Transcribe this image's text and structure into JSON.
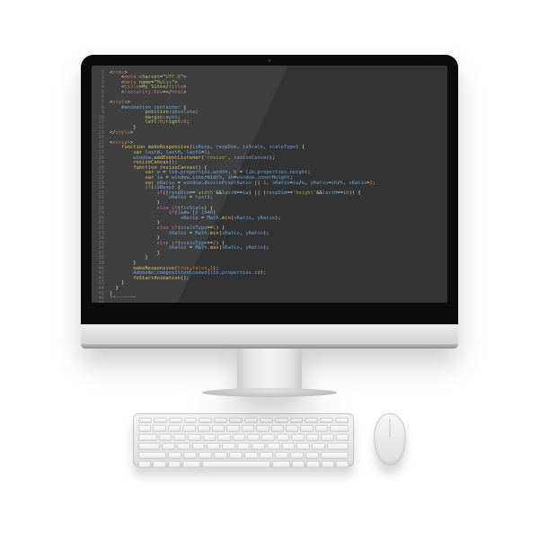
{
  "editor": {
    "line_count": 47,
    "code": [
      [
        [
          "pun",
          "<"
        ],
        [
          "tag",
          "html"
        ],
        [
          "pun",
          ">"
        ]
      ],
      [
        [
          "pun",
          "    <"
        ],
        [
          "tag",
          "meta "
        ],
        [
          "attr",
          "charset"
        ],
        [
          "pun",
          "=\""
        ],
        [
          "str",
          "UTF-8"
        ],
        [
          "pun",
          "\">"
        ]
      ],
      [
        [
          "pun",
          "    <"
        ],
        [
          "tag",
          "meta "
        ],
        [
          "attr",
          "name"
        ],
        [
          "pun",
          "=\""
        ],
        [
          "str",
          "MyCss"
        ],
        [
          "pun",
          "\">"
        ]
      ],
      [
        [
          "pun",
          "    <"
        ],
        [
          "tag",
          "title"
        ],
        [
          "pun",
          ">"
        ],
        [
          "attr",
          "My Site"
        ],
        [
          "pun",
          "</"
        ],
        [
          "tag",
          "title"
        ],
        [
          "pun",
          ">"
        ]
      ],
      [
        [
          "pun",
          "    <"
        ],
        [
          "ctrl",
          "!security.Dev"
        ],
        [
          "pun",
          "=</"
        ],
        [
          "tag",
          "html"
        ],
        [
          "pun",
          ">"
        ]
      ],
      [],
      [
        [
          "pun",
          "<"
        ],
        [
          "tag",
          "style"
        ],
        [
          "pun",
          ">"
        ]
      ],
      [
        [
          "pun",
          "    "
        ],
        [
          "id",
          "#animation_container"
        ],
        [
          "pun",
          " {"
        ]
      ],
      [
        [
          "pun",
          "            "
        ],
        [
          "attr",
          "position"
        ],
        [
          "pun",
          ":"
        ],
        [
          "id",
          "absolute"
        ],
        [
          "pun",
          ";"
        ]
      ],
      [
        [
          "pun",
          "            "
        ],
        [
          "attr",
          "margin"
        ],
        [
          "pun",
          ":"
        ],
        [
          "id",
          "auto"
        ],
        [
          "pun",
          ";"
        ]
      ],
      [
        [
          "pun",
          "            "
        ],
        [
          "attr",
          "left"
        ],
        [
          "pun",
          ":"
        ],
        [
          "num",
          "0"
        ],
        [
          "pun",
          ";"
        ],
        [
          "attr",
          "right"
        ],
        [
          "pun",
          ":"
        ],
        [
          "num",
          "0"
        ],
        [
          "pun",
          ";"
        ]
      ],
      [
        [
          "pun",
          "        }"
        ]
      ],
      [
        [
          "pun",
          "</"
        ],
        [
          "tag",
          "style"
        ],
        [
          "pun",
          ">"
        ]
      ],
      [],
      [
        [
          "pun",
          "<"
        ],
        [
          "tag",
          "script"
        ],
        [
          "pun",
          ">"
        ]
      ],
      [
        [
          "pun",
          "    "
        ],
        [
          "kw",
          "function "
        ],
        [
          "fn",
          "makeResponsive"
        ],
        [
          "pun",
          "("
        ],
        [
          "id",
          "isResp"
        ],
        [
          "pun",
          ", "
        ],
        [
          "id",
          "respDim"
        ],
        [
          "pun",
          ", "
        ],
        [
          "id",
          "isScale"
        ],
        [
          "pun",
          ", "
        ],
        [
          "id",
          "scaleType"
        ],
        [
          "pun",
          ") {"
        ]
      ],
      [
        [
          "pun",
          "        "
        ],
        [
          "kw",
          "var "
        ],
        [
          "id",
          "lastW"
        ],
        [
          "pun",
          ", "
        ],
        [
          "id",
          "lastH"
        ],
        [
          "pun",
          ", "
        ],
        [
          "id",
          "lastS"
        ],
        [
          "pun",
          "="
        ],
        [
          "num",
          "1"
        ],
        [
          "pun",
          ";"
        ]
      ],
      [
        [
          "pun",
          "        "
        ],
        [
          "id",
          "window"
        ],
        [
          "pun",
          "."
        ],
        [
          "fn",
          "addEventListener"
        ],
        [
          "pun",
          "("
        ],
        [
          "str",
          "'resize'"
        ],
        [
          "pun",
          ", "
        ],
        [
          "id",
          "resizeCanvas"
        ],
        [
          "pun",
          ");"
        ]
      ],
      [
        [
          "pun",
          "        "
        ],
        [
          "fn",
          "resizeCanvas"
        ],
        [
          "pun",
          "();"
        ]
      ],
      [
        [
          "pun",
          "        "
        ],
        [
          "kw",
          "function "
        ],
        [
          "fn",
          "resizeCanvas"
        ],
        [
          "pun",
          "() {"
        ]
      ],
      [
        [
          "pun",
          "            "
        ],
        [
          "kw",
          "var "
        ],
        [
          "id",
          "w "
        ],
        [
          "pun",
          "= "
        ],
        [
          "id",
          "lib"
        ],
        [
          "pun",
          "."
        ],
        [
          "id",
          "properties"
        ],
        [
          "pun",
          "."
        ],
        [
          "id",
          "width"
        ],
        [
          "pun",
          ", "
        ],
        [
          "id",
          "h "
        ],
        [
          "pun",
          "= "
        ],
        [
          "id",
          "lib"
        ],
        [
          "pun",
          "."
        ],
        [
          "id",
          "properties"
        ],
        [
          "pun",
          "."
        ],
        [
          "id",
          "height"
        ],
        [
          "pun",
          ";"
        ]
      ],
      [
        [
          "pun",
          "            "
        ],
        [
          "kw",
          "var "
        ],
        [
          "id",
          "iw "
        ],
        [
          "pun",
          "= "
        ],
        [
          "id",
          "window"
        ],
        [
          "pun",
          "."
        ],
        [
          "id",
          "innerWidth"
        ],
        [
          "pun",
          ", "
        ],
        [
          "id",
          "ih"
        ],
        [
          "pun",
          "="
        ],
        [
          "id",
          "window"
        ],
        [
          "pun",
          "."
        ],
        [
          "id",
          "innerHeight"
        ],
        [
          "pun",
          ";"
        ]
      ],
      [
        [
          "pun",
          "            "
        ],
        [
          "kw",
          "var "
        ],
        [
          "id",
          "pRatio "
        ],
        [
          "pun",
          "= "
        ],
        [
          "id",
          "window"
        ],
        [
          "pun",
          "."
        ],
        [
          "id",
          "devicePixelRatio "
        ],
        [
          "pun",
          "|| "
        ],
        [
          "num",
          "1"
        ],
        [
          "pun",
          ", "
        ],
        [
          "id",
          "xRatio"
        ],
        [
          "pun",
          "="
        ],
        [
          "id",
          "iw"
        ],
        [
          "pun",
          "/"
        ],
        [
          "id",
          "w"
        ],
        [
          "pun",
          ", "
        ],
        [
          "id",
          "yRatio"
        ],
        [
          "pun",
          "="
        ],
        [
          "id",
          "ih"
        ],
        [
          "pun",
          "/"
        ],
        [
          "id",
          "h"
        ],
        [
          "pun",
          ", "
        ],
        [
          "id",
          "sRatio"
        ],
        [
          "pun",
          "="
        ],
        [
          "num",
          "1"
        ],
        [
          "pun",
          ";"
        ]
      ],
      [
        [
          "pun",
          "            "
        ],
        [
          "ctrl",
          "if"
        ],
        [
          "pun",
          "("
        ],
        [
          "id",
          "isResp"
        ],
        [
          "pun",
          ") {"
        ]
      ],
      [
        [
          "pun",
          "                "
        ],
        [
          "ctrl",
          "if"
        ],
        [
          "pun",
          "(("
        ],
        [
          "id",
          "respDim"
        ],
        [
          "pun",
          "=="
        ],
        [
          "str",
          "'width'"
        ],
        [
          "pun",
          "&&"
        ],
        [
          "id",
          "lastW"
        ],
        [
          "pun",
          "=="
        ],
        [
          "id",
          "iw"
        ],
        [
          "pun",
          ") || ("
        ],
        [
          "id",
          "respDim"
        ],
        [
          "pun",
          "=="
        ],
        [
          "str",
          "'height'"
        ],
        [
          "pun",
          "&&"
        ],
        [
          "id",
          "lastH"
        ],
        [
          "pun",
          "=="
        ],
        [
          "id",
          "ih"
        ],
        [
          "pun",
          ")) {"
        ]
      ],
      [
        [
          "pun",
          "                    "
        ],
        [
          "id",
          "sRatio "
        ],
        [
          "pun",
          "= "
        ],
        [
          "id",
          "lastS"
        ],
        [
          "pun",
          ";"
        ]
      ],
      [
        [
          "pun",
          "                }"
        ]
      ],
      [
        [
          "pun",
          "                "
        ],
        [
          "ctrl",
          "else if"
        ],
        [
          "pun",
          "(!"
        ],
        [
          "id",
          "isScale"
        ],
        [
          "pun",
          ") {"
        ]
      ],
      [
        [
          "pun",
          "                    "
        ],
        [
          "ctrl",
          "if"
        ],
        [
          "pun",
          "("
        ],
        [
          "id",
          "iw"
        ],
        [
          "pun",
          "<"
        ],
        [
          "id",
          "w "
        ],
        [
          "pun",
          "|| "
        ],
        [
          "id",
          "ih"
        ],
        [
          "pun",
          "<"
        ],
        [
          "id",
          "h"
        ],
        [
          "pun",
          ")"
        ]
      ],
      [
        [
          "pun",
          "                        "
        ],
        [
          "id",
          "sRatio "
        ],
        [
          "pun",
          "= "
        ],
        [
          "id",
          "Math"
        ],
        [
          "pun",
          "."
        ],
        [
          "fn",
          "min"
        ],
        [
          "pun",
          "("
        ],
        [
          "id",
          "xRatio"
        ],
        [
          "pun",
          ", "
        ],
        [
          "id",
          "yRatio"
        ],
        [
          "pun",
          ");"
        ]
      ],
      [
        [
          "pun",
          "                }"
        ]
      ],
      [
        [
          "pun",
          "                "
        ],
        [
          "ctrl",
          "else if"
        ],
        [
          "pun",
          "("
        ],
        [
          "id",
          "scaleType"
        ],
        [
          "pun",
          "=="
        ],
        [
          "num",
          "1"
        ],
        [
          "pun",
          ") {"
        ]
      ],
      [
        [
          "pun",
          "                    "
        ],
        [
          "id",
          "sRatio "
        ],
        [
          "pun",
          "= "
        ],
        [
          "id",
          "Math"
        ],
        [
          "pun",
          "."
        ],
        [
          "fn",
          "min"
        ],
        [
          "pun",
          "("
        ],
        [
          "id",
          "xRatio"
        ],
        [
          "pun",
          ", "
        ],
        [
          "id",
          "yRatio"
        ],
        [
          "pun",
          ");"
        ]
      ],
      [
        [
          "pun",
          "                }"
        ]
      ],
      [
        [
          "pun",
          "                "
        ],
        [
          "ctrl",
          "else if"
        ],
        [
          "pun",
          "("
        ],
        [
          "id",
          "scaleType"
        ],
        [
          "pun",
          "=="
        ],
        [
          "num",
          "2"
        ],
        [
          "pun",
          ") {"
        ]
      ],
      [
        [
          "pun",
          "                    "
        ],
        [
          "id",
          "sRatio "
        ],
        [
          "pun",
          "= "
        ],
        [
          "id",
          "Math"
        ],
        [
          "pun",
          "."
        ],
        [
          "fn",
          "max"
        ],
        [
          "pun",
          "("
        ],
        [
          "id",
          "xRatio"
        ],
        [
          "pun",
          ", "
        ],
        [
          "id",
          "yRatio"
        ],
        [
          "pun",
          ");"
        ]
      ],
      [
        [
          "pun",
          "                }"
        ]
      ],
      [
        [
          "pun",
          "            }"
        ]
      ],
      [
        [
          "pun",
          "        }"
        ]
      ],
      [
        [
          "pun",
          "        "
        ],
        [
          "fn",
          "makeResponsive"
        ],
        [
          "pun",
          "("
        ],
        [
          "lit",
          "true"
        ],
        [
          "pun",
          ","
        ],
        [
          "lit",
          "false"
        ],
        [
          "pun",
          ","
        ],
        [
          "num",
          "1"
        ],
        [
          "pun",
          ");"
        ]
      ],
      [
        [
          "pun",
          "        "
        ],
        [
          "id",
          "AdobeAn"
        ],
        [
          "pun",
          "."
        ],
        [
          "id",
          "compositionLoaded"
        ],
        [
          "pun",
          "("
        ],
        [
          "id",
          "lib"
        ],
        [
          "pun",
          "."
        ],
        [
          "id",
          "properties"
        ],
        [
          "pun",
          "."
        ],
        [
          "id",
          "id"
        ],
        [
          "pun",
          ");"
        ]
      ],
      [
        [
          "pun",
          "        "
        ],
        [
          "fn",
          "fnStartAnimation"
        ],
        [
          "pun",
          "();"
        ]
      ],
      [
        [
          "pun",
          "    }"
        ]
      ],
      [
        [
          "pun",
          "  }"
        ]
      ],
      [
        [
          "pun",
          "}"
        ]
      ],
      [
        [
          "pun",
          "</"
        ],
        [
          "tag",
          "script"
        ],
        [
          "pun",
          ">"
        ]
      ],
      []
    ]
  }
}
